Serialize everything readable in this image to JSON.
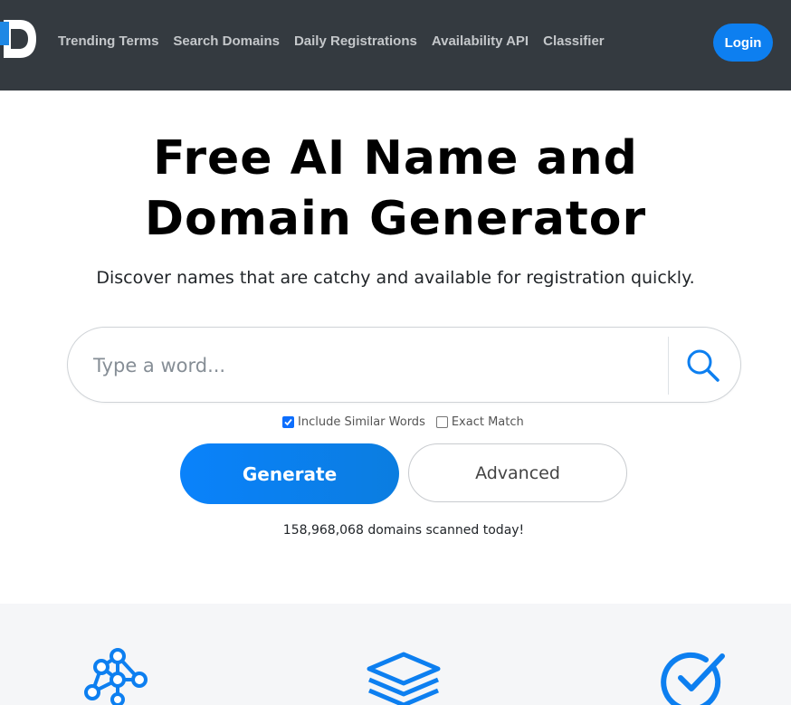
{
  "nav": {
    "links": [
      "Trending Terms",
      "Search Domains",
      "Daily Registrations",
      "Availability API",
      "Classifier"
    ],
    "login_label": "Login"
  },
  "hero": {
    "title_line1": "Free AI Name and",
    "title_line2": "Domain Generator",
    "subtitle": "Discover names that are catchy and available for registration quickly."
  },
  "search": {
    "placeholder": "Type a word...",
    "value": ""
  },
  "options": {
    "similar_label": "Include Similar Words",
    "similar_checked": true,
    "exact_label": "Exact Match",
    "exact_checked": false
  },
  "buttons": {
    "generate_label": "Generate",
    "advanced_label": "Advanced"
  },
  "stats": {
    "scanned_text": "158,968,068 domains scanned today!"
  },
  "features": {
    "icons": [
      "network-icon",
      "layers-icon",
      "check-circle-icon"
    ]
  },
  "colors": {
    "navbar": "#343a40",
    "accent": "#0d7ff0",
    "features_bg": "#f5f6f8"
  }
}
